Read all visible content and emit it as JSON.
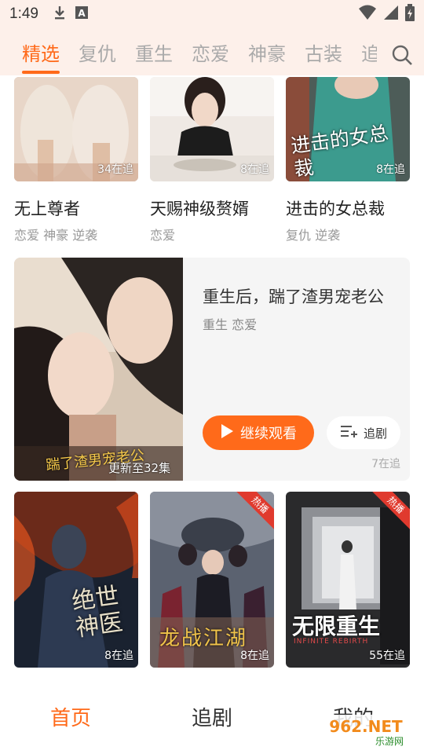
{
  "status": {
    "time": "1:49",
    "icons": [
      "download-icon",
      "text-a-icon",
      "wifi-icon",
      "signal-icon",
      "battery-icon"
    ]
  },
  "tabs": [
    {
      "label": "精选",
      "active": true
    },
    {
      "label": "复仇"
    },
    {
      "label": "重生"
    },
    {
      "label": "恋爱"
    },
    {
      "label": "神豪"
    },
    {
      "label": "古装"
    },
    {
      "label": "追"
    }
  ],
  "top_row": [
    {
      "title": "无上尊者",
      "tags": "恋爱 神豪 逆袭",
      "count": "34在追"
    },
    {
      "title": "天赐神级赘婿",
      "tags": "恋爱",
      "count": "8在追"
    },
    {
      "title": "进击的女总裁",
      "tags": "复仇 逆袭",
      "count": "8在追",
      "poster_text": "进击的女总裁"
    }
  ],
  "feature": {
    "title": "重生后，踹了渣男宠老公",
    "tags": "重生 恋爱",
    "update": "更新至32集",
    "poster_text": "踹了渣男宠老公",
    "watch_label": "继续观看",
    "follow_label": "追剧",
    "count": "7在追"
  },
  "bottom_row": [
    {
      "count": "8在追",
      "poster_text": "绝世神医",
      "hot": false
    },
    {
      "count": "8在追",
      "poster_text": "龙战江湖",
      "hot": true,
      "hot_label": "热播"
    },
    {
      "count": "55在追",
      "poster_text": "无限重生",
      "poster_subtext": "INFINITE REBIRTH",
      "hot": true,
      "hot_label": "热播"
    }
  ],
  "nav": [
    {
      "label": "首页",
      "active": true
    },
    {
      "label": "追剧"
    },
    {
      "label": "我的"
    }
  ],
  "watermark": {
    "main": "962.NET",
    "sub": "乐游网"
  },
  "colors": {
    "accent": "#ff6a1a",
    "tab_inactive": "#aaaaaa",
    "header_bg": "#fdf0ea"
  }
}
